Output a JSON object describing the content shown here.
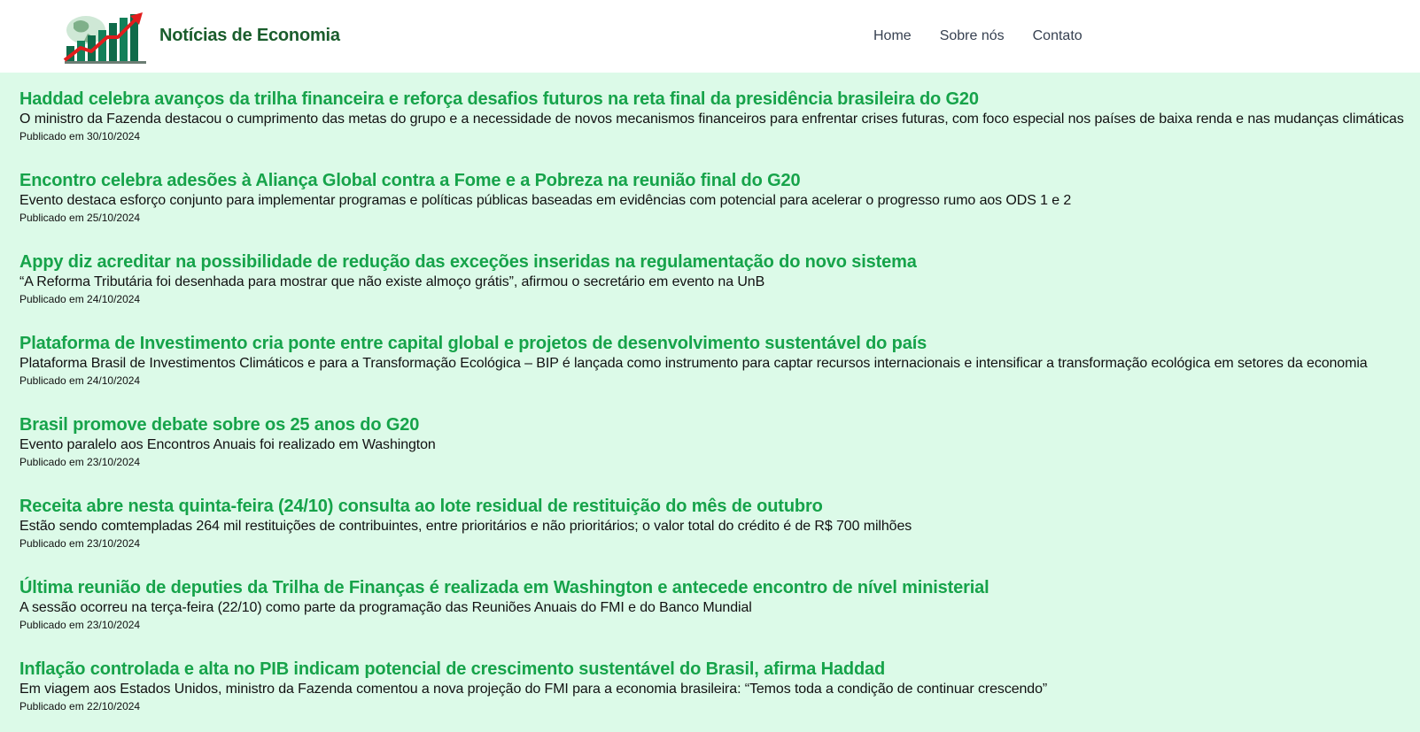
{
  "header": {
    "brand": "Notícias de Economia",
    "logo_icon": "rising-chart-logo",
    "nav": [
      {
        "label": "Home"
      },
      {
        "label": "Sobre nós"
      },
      {
        "label": "Contato"
      }
    ]
  },
  "colors": {
    "header_bg": "#ffffff",
    "page_bg": "#dcfae8",
    "brand": "#1a5d2c",
    "title": "#16a34a"
  },
  "articles": [
    {
      "title": "Haddad celebra avanços da trilha financeira e reforça desafios futuros na reta final da presidência brasileira do G20",
      "summary": "O ministro da Fazenda destacou o cumprimento das metas do grupo e a necessidade de novos mecanismos financeiros para enfrentar crises futuras, com foco especial nos países de baixa renda e nas mudanças climáticas",
      "date": "Publicado em 30/10/2024"
    },
    {
      "title": "Encontro celebra adesões à Aliança Global contra a Fome e a Pobreza na reunião final do G20",
      "summary": "Evento destaca esforço conjunto para implementar programas e políticas públicas baseadas em evidências com potencial para acelerar o progresso rumo aos ODS 1 e 2",
      "date": "Publicado em 25/10/2024"
    },
    {
      "title": "Appy diz acreditar na possibilidade de redução das exceções inseridas na regulamentação do novo sistema",
      "summary": "“A Reforma Tributária foi desenhada para mostrar que não existe almoço grátis”, afirmou o secretário em evento na UnB",
      "date": "Publicado em 24/10/2024"
    },
    {
      "title": "Plataforma de Investimento cria ponte entre capital global e projetos de desenvolvimento sustentável do país",
      "summary": "Plataforma Brasil de Investimentos Climáticos e para a Transformação Ecológica – BIP é lançada como instrumento para captar recursos internacionais e intensificar a transformação ecológica em setores da economia",
      "date": "Publicado em 24/10/2024"
    },
    {
      "title": "Brasil promove debate sobre os 25 anos do G20",
      "summary": "Evento paralelo aos Encontros Anuais foi realizado em Washington",
      "date": "Publicado em 23/10/2024"
    },
    {
      "title": "Receita abre nesta quinta-feira (24/10) consulta ao lote residual de restituição do mês de outubro",
      "summary": "Estão sendo comtempladas 264 mil restituições de contribuintes, entre prioritários e não prioritários; o valor total do crédito é de R$ 700 milhões",
      "date": "Publicado em 23/10/2024"
    },
    {
      "title": "Última reunião de deputies da Trilha de Finanças é realizada em Washington e antecede encontro de nível ministerial",
      "summary": "A sessão ocorreu na terça-feira (22/10) como parte da programação das Reuniões Anuais do FMI e do Banco Mundial",
      "date": "Publicado em 23/10/2024"
    },
    {
      "title": "Inflação controlada e alta no PIB indicam potencial de crescimento sustentável do Brasil, afirma Haddad",
      "summary": "Em viagem aos Estados Unidos, ministro da Fazenda comentou a nova projeção do FMI para a economia brasileira: “Temos toda a condição de continuar crescendo”",
      "date": "Publicado em 22/10/2024"
    }
  ]
}
